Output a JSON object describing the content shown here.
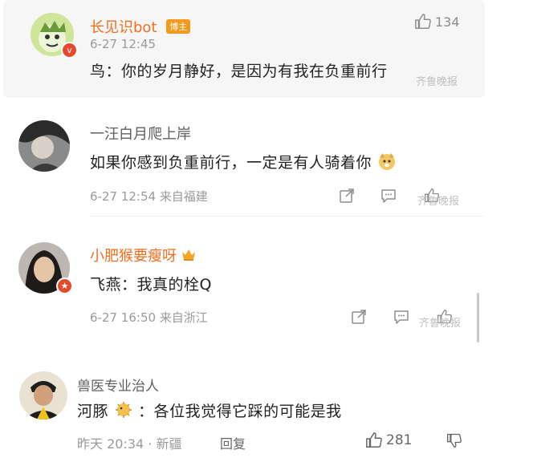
{
  "comments": [
    {
      "name": "长见识bot",
      "badge": "博主",
      "time": "6-27 12:45",
      "text": "鸟：你的岁月静好，是因为有我在负重前行",
      "likes": "134"
    },
    {
      "name": "一汪白月爬上岸",
      "text": "如果你感到负重前行，一定是有人骑着你",
      "time_location": "6-27 12:54 来自福建"
    },
    {
      "name": "小肥猴要瘦呀",
      "text": "飞燕：我真的栓Q",
      "time_location": "6-27 16:50 来自浙江"
    },
    {
      "name": "兽医专业治人",
      "text_prefix": "河豚",
      "text_suffix": "：各位我觉得它踩的可能是我",
      "time_location": "昨天 20:34 · 新疆",
      "reply_label": "回复",
      "likes": "281"
    }
  ],
  "watermark": "齐鲁晚报",
  "colors": {
    "accent_orange": "#f46e1f",
    "badge_bg": "#f39a1a",
    "verified_red": "#e8482b"
  }
}
